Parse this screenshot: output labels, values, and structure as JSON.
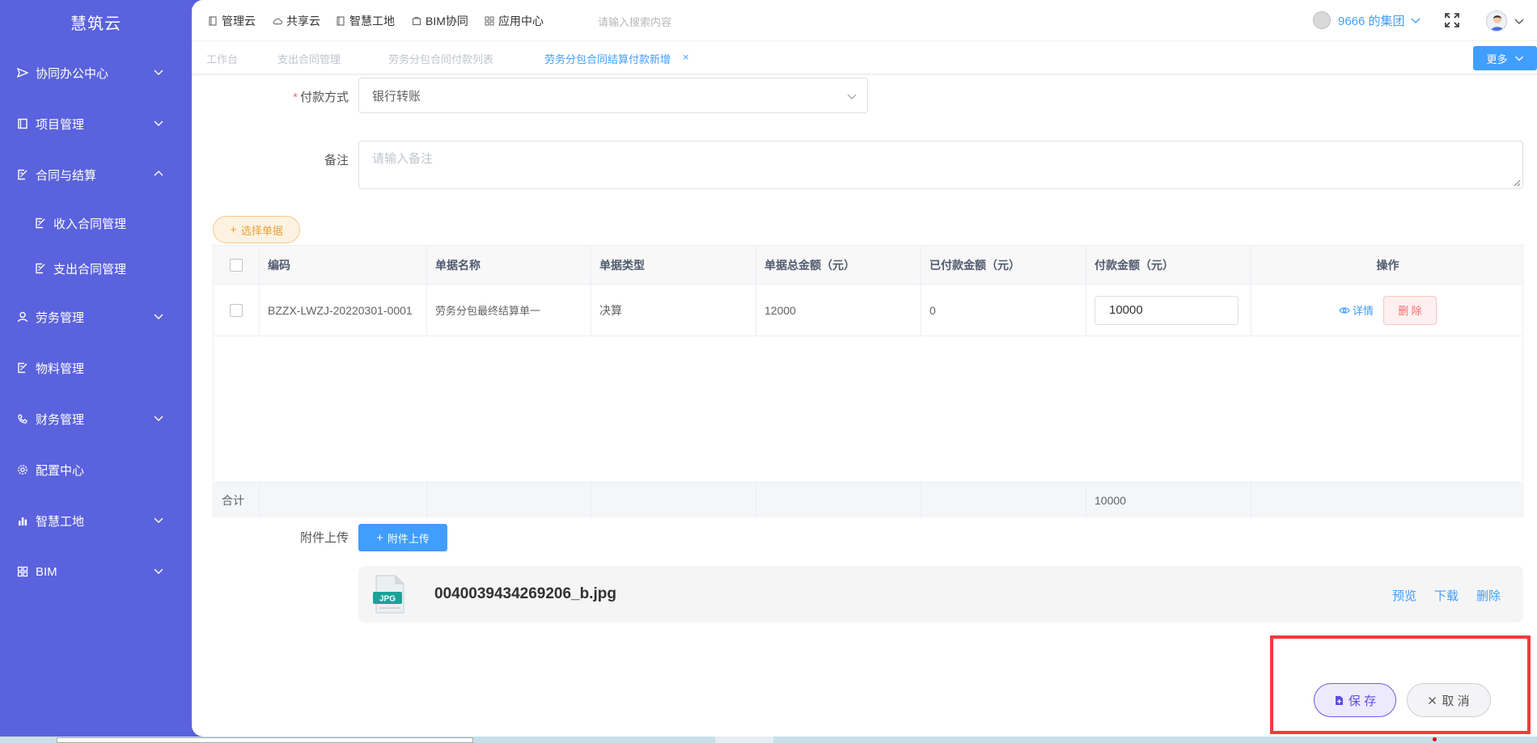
{
  "sidebar": {
    "logo": "慧筑云",
    "items": [
      {
        "label": "协同办公中心",
        "icon": "send-icon",
        "expandable": true
      },
      {
        "label": "项目管理",
        "icon": "book-icon",
        "expandable": true
      },
      {
        "label": "合同与结算",
        "icon": "edit-doc-icon",
        "expandable": true,
        "expanded": true
      },
      {
        "label": "收入合同管理",
        "icon": "edit-doc-icon",
        "sub": true
      },
      {
        "label": "支出合同管理",
        "icon": "edit-doc-icon",
        "sub": true
      },
      {
        "label": "劳务管理",
        "icon": "worker-icon",
        "expandable": true
      },
      {
        "label": "物料管理",
        "icon": "edit-doc-icon",
        "expandable": false
      },
      {
        "label": "财务管理",
        "icon": "phone-icon",
        "expandable": true
      },
      {
        "label": "配置中心",
        "icon": "gear-icon",
        "expandable": false
      },
      {
        "label": "智慧工地",
        "icon": "bar-chart-icon",
        "expandable": true
      },
      {
        "label": "BIM",
        "icon": "grid-icon",
        "expandable": true
      }
    ]
  },
  "topbar": {
    "links": [
      "管理云",
      "共享云",
      "智慧工地",
      "BIM协同",
      "应用中心"
    ],
    "search_placeholder": "请输入搜索内容",
    "group": "9666 的集团"
  },
  "tabs": {
    "items": [
      "工作台",
      "支出合同管理",
      "劳务分包合同付款列表",
      "劳务分包合同结算付款新增"
    ],
    "active_index": 3,
    "close_glyph": "×",
    "more_label": "更多"
  },
  "form": {
    "payment_method_label": "付款方式",
    "required_mark": "*",
    "payment_method_value": "银行转账",
    "remark_label": "备注",
    "remark_placeholder": "请输入备注",
    "pick_button": "选择单据"
  },
  "table": {
    "headers": [
      "编码",
      "单据名称",
      "单据类型",
      "单据总金额（元）",
      "已付款金额（元）",
      "付款金额（元）",
      "操作"
    ],
    "rows": [
      {
        "code": "BZZX-LWZJ-20220301-0001",
        "name": "劳务分包最终结算单一",
        "type": "决算",
        "total": "12000",
        "paid": "0",
        "pay": "10000"
      }
    ],
    "detail_label": "详情",
    "delete_label": "删 除",
    "sum_label": "合计",
    "sum_pay": "10000"
  },
  "attachment": {
    "label": "附件上传",
    "button": "附件上传",
    "file_type": "JPG",
    "file_name": "0040039434269206_b.jpg",
    "actions": [
      "预览",
      "下载",
      "删除"
    ]
  },
  "footer": {
    "save_label": "保 存",
    "cancel_label": "取 消"
  },
  "colors": {
    "sidebar": "#5a62dd",
    "primary": "#409eff",
    "danger": "#f56c6c",
    "highlight": "#f13b3b"
  }
}
